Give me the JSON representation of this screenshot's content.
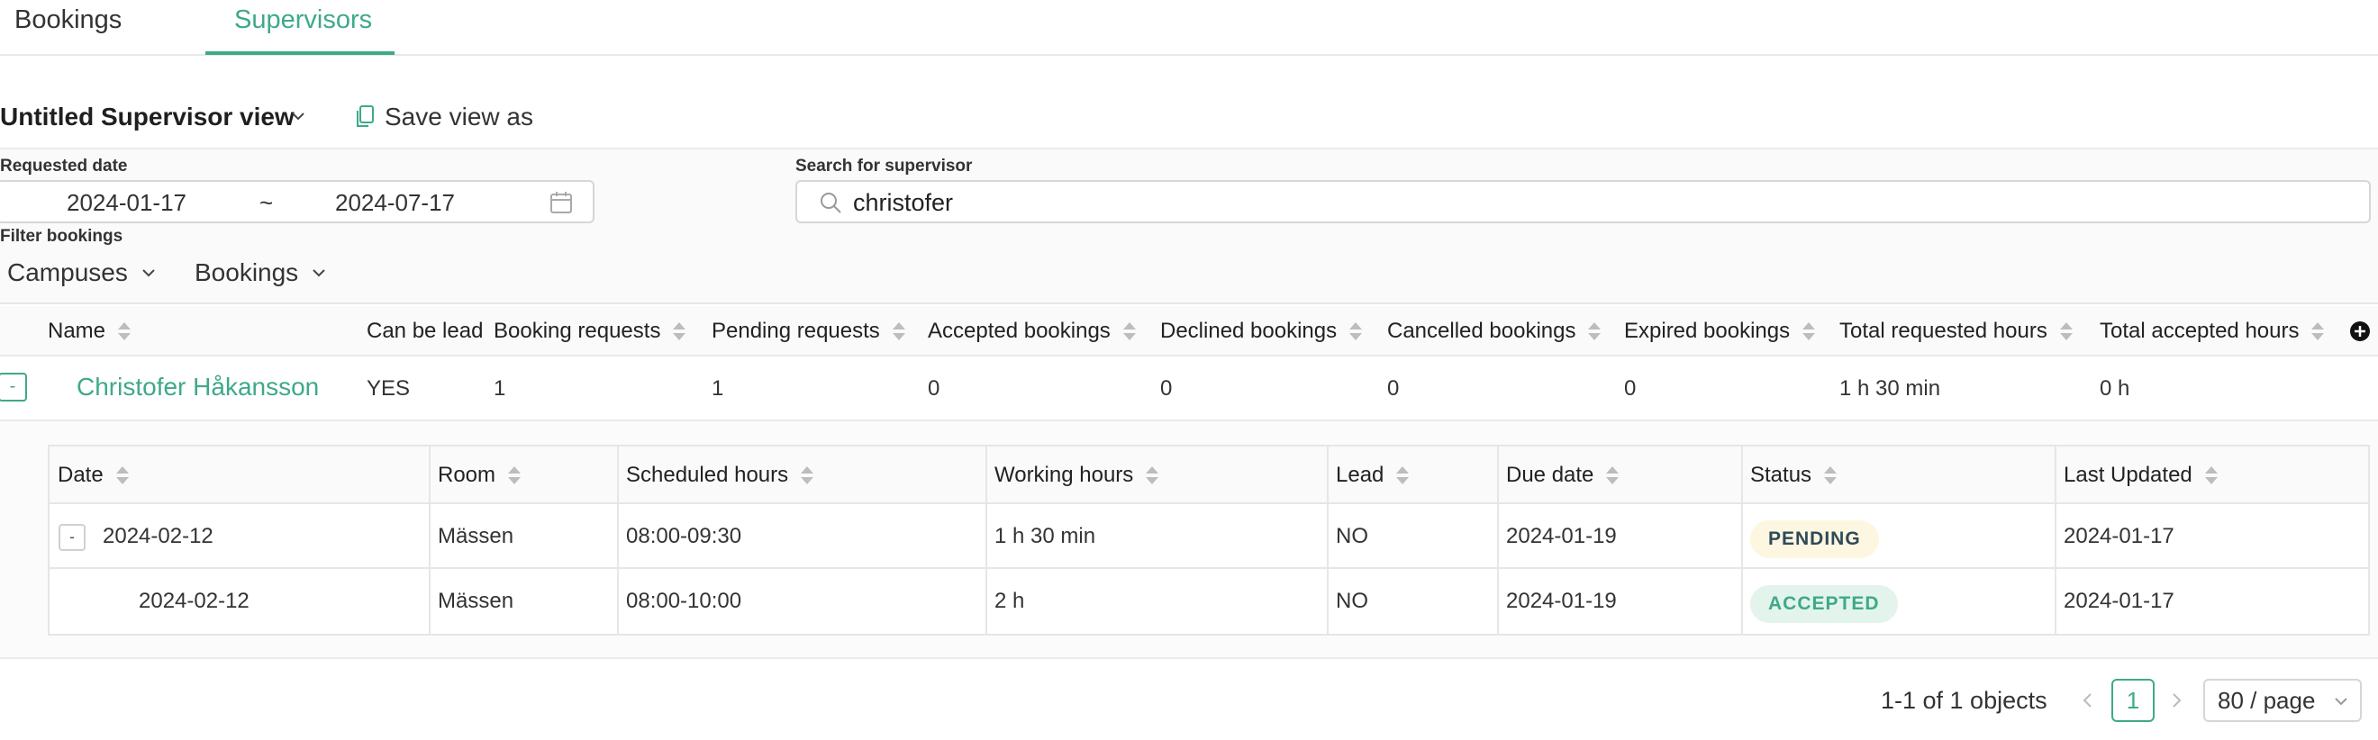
{
  "tabs": [
    {
      "label": "Bookings",
      "active": false
    },
    {
      "label": "Supervisors",
      "active": true
    }
  ],
  "view": {
    "title": "Untitled Supervisor view",
    "save_label": "Save view as"
  },
  "filters": {
    "requested_date_label": "Requested date",
    "date_from": "2024-01-17",
    "date_separator": "~",
    "date_to": "2024-07-17",
    "search_label": "Search for supervisor",
    "search_value": "christofer",
    "filter_bookings_label": "Filter bookings",
    "campuses_label": "Campuses",
    "bookings_label": "Bookings"
  },
  "main_table": {
    "columns": [
      "Name",
      "Can be lead",
      "Booking requests",
      "Pending requests",
      "Accepted bookings",
      "Declined bookings",
      "Cancelled bookings",
      "Expired bookings",
      "Total requested hours",
      "Total accepted hours"
    ],
    "rows": [
      {
        "expand": "-",
        "name": "Christofer Håkansson",
        "can_be_lead": "YES",
        "booking_requests": "1",
        "pending_requests": "1",
        "accepted_bookings": "0",
        "declined_bookings": "0",
        "cancelled_bookings": "0",
        "expired_bookings": "0",
        "total_requested_hours": "1 h 30 min",
        "total_accepted_hours": "0 h"
      }
    ]
  },
  "nested_table": {
    "columns": [
      "Date",
      "Room",
      "Scheduled hours",
      "Working hours",
      "Lead",
      "Due date",
      "Status",
      "Last Updated"
    ],
    "rows": [
      {
        "expand": "-",
        "date": "2024-02-12",
        "room": "Mässen",
        "scheduled": "08:00-09:30",
        "working": "1 h 30 min",
        "lead": "NO",
        "due": "2024-01-19",
        "status": "PENDING",
        "updated": "2024-01-17"
      },
      {
        "date": "2024-02-12",
        "room": "Mässen",
        "scheduled": "08:00-10:00",
        "working": "2 h",
        "lead": "NO",
        "due": "2024-01-19",
        "status": "ACCEPTED",
        "updated": "2024-01-17"
      }
    ]
  },
  "pagination": {
    "summary": "1-1 of 1 objects",
    "current_page": "1",
    "page_size": "80 / page"
  },
  "colors": {
    "accent": "#3fa98a",
    "pending_bg": "#fdf7e1",
    "accepted_bg": "#e3f4ec"
  }
}
